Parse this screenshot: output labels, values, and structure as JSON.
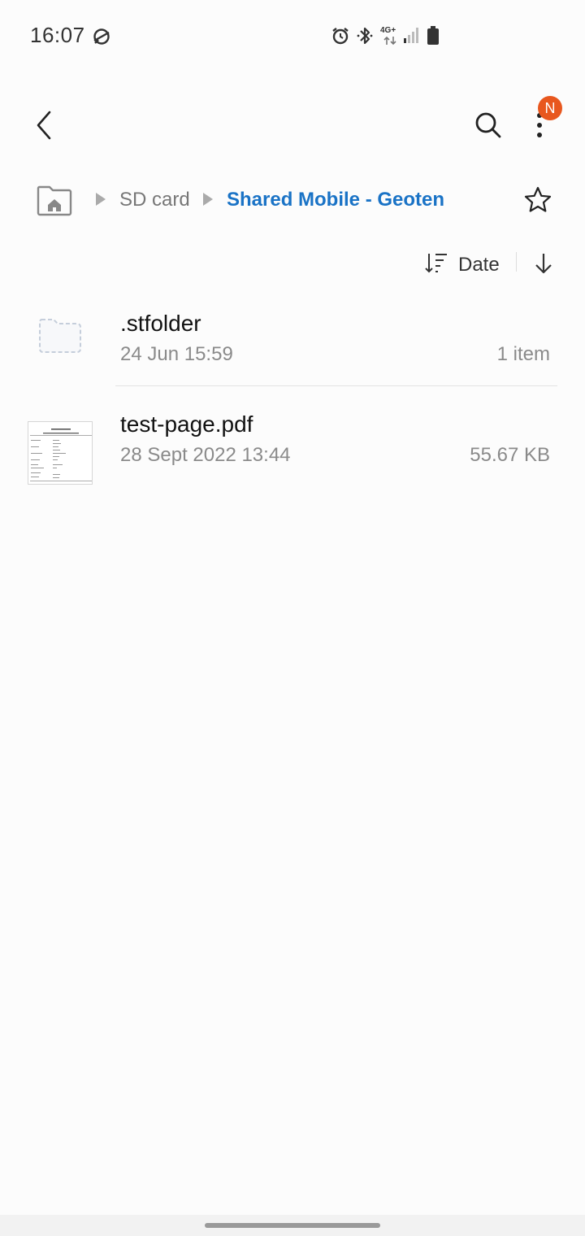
{
  "status_bar": {
    "time": "16:07",
    "network_label": "4G+",
    "icons": [
      "sync-icon",
      "alarm-icon",
      "bluetooth-icon",
      "network-4g-icon",
      "signal-icon",
      "battery-icon"
    ]
  },
  "toolbar": {
    "icons": [
      "back-icon",
      "search-icon",
      "more-options-icon"
    ],
    "badge_text": "N",
    "badge_color": "#e8571e"
  },
  "breadcrumb": {
    "items": [
      {
        "label": "SD card"
      },
      {
        "label": "Shared Mobile - Geoten"
      }
    ],
    "active_color": "#1a73c6",
    "icons": [
      "storage-home-icon",
      "chevron-right-icon",
      "favorite-star-icon"
    ]
  },
  "sort": {
    "label": "Date",
    "icons": [
      "sort-icon",
      "sort-direction-icon"
    ]
  },
  "files": [
    {
      "name": ".stfolder",
      "date": "24 Jun 15:59",
      "size": "1 item",
      "icon": "folder-icon"
    },
    {
      "name": "test-page.pdf",
      "date": "28 Sept 2022 13:44",
      "size": "55.67 KB",
      "icon": "pdf-thumbnail"
    }
  ]
}
